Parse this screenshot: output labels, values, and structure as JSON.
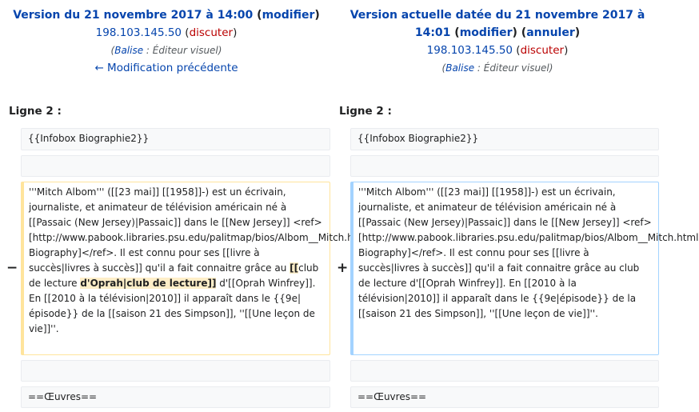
{
  "left_header": {
    "title": "Version du 21 novembre 2017 à 14:00",
    "edit_label": "modifier",
    "user_ip": "198.103.145.50",
    "talk_label": "discuter",
    "tag_label": "Balise",
    "tag_value": "Éditeur visuel",
    "prev_link": "← Modification précédente"
  },
  "right_header": {
    "title_line1": "Version actuelle datée du 21 novembre 2017 à",
    "title_line2": "14:01",
    "edit_label": "modifier",
    "undo_label": "annuler",
    "user_ip": "198.103.145.50",
    "talk_label": "discuter",
    "tag_label": "Balise",
    "tag_value": "Éditeur visuel"
  },
  "line_label_left": "Ligne 2 :",
  "line_label_right": "Ligne 2 :",
  "markers": {
    "removed": "−",
    "added": "+"
  },
  "diff": {
    "context_first": "{{Infobox Biographie2}}",
    "context_last": "==Œuvres==",
    "left_block": {
      "before": "'''Mitch Albom''' ([[23 mai]] [[1958]]-) est un écrivain, journaliste, et animateur de télévision américain né à [[Passaic (New Jersey)|Passaic]] dans le [[New Jersey]] <ref>[http://www.pabook.libraries.psu.edu/palitmap/bios/Albom__Mitch.html Biography]</ref>. Il est connu pour ses [[livre à succès|livres à succès]] qu'il a fait connaitre grâce au ",
      "highlight_1": "[[",
      "middle": "club de lecture ",
      "highlight_2": "d'Oprah|club de lecture]]",
      "after": " d'[[Oprah Winfrey]]. En [[2010 à la télévision|2010]] il apparaît dans le {{9e|épisode}} de la [[saison 21 des Simpson]], ''[[Une leçon de vie]]''."
    },
    "right_block": "'''Mitch Albom''' ([[23 mai]] [[1958]]-) est un écrivain, journaliste, et animateur de télévision américain né à [[Passaic (New Jersey)|Passaic]] dans le [[New Jersey]] <ref>[http://www.pabook.libraries.psu.edu/palitmap/bios/Albom__Mitch.html Biography]</ref>. Il est connu pour ses [[livre à succès|livres à succès]] qu'il a fait connaitre grâce au club de lecture d'[[Oprah Winfrey]]. En [[2010 à la télévision|2010]] il apparaît dans le {{9e|épisode}} de la [[saison 21 des Simpson]], ''[[Une leçon de vie]]''."
  }
}
